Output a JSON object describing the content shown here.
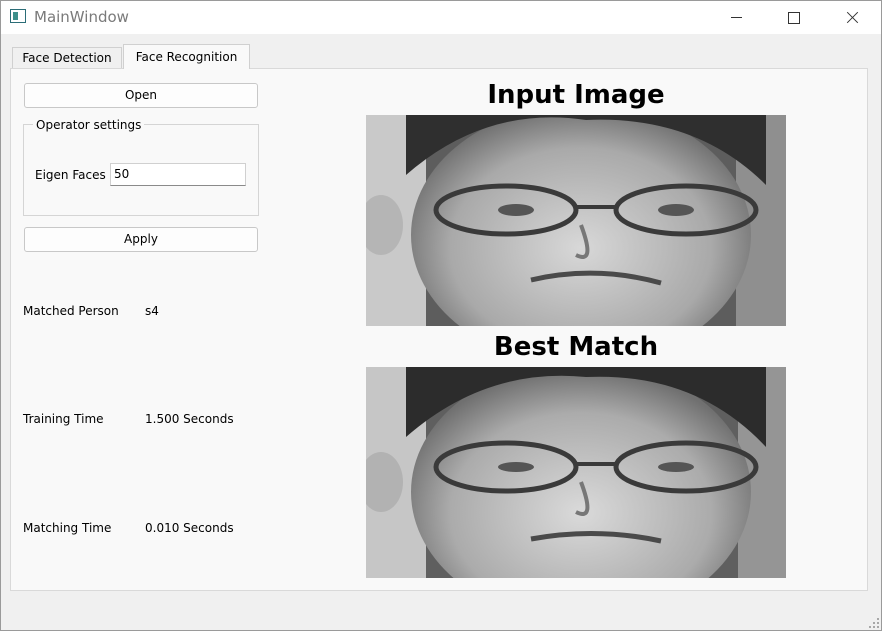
{
  "window": {
    "title": "MainWindow"
  },
  "tabs": [
    {
      "label": "Face Detection"
    },
    {
      "label": "Face Recognition"
    }
  ],
  "controls": {
    "open_label": "Open",
    "apply_label": "Apply",
    "group_title": "Operator settings",
    "eigen_label": "Eigen Faces",
    "eigen_value": "50"
  },
  "results": {
    "matched_person_label": "Matched Person",
    "matched_person_value": "s4",
    "training_time_label": "Training Time",
    "training_time_value": "1.500 Seconds",
    "matching_time_label": "Matching Time",
    "matching_time_value": "0.010 Seconds"
  },
  "images": {
    "input_heading": "Input Image",
    "best_heading": "Best Match"
  },
  "icons": {
    "app": "app-icon",
    "minimize": "minimize-icon",
    "maximize": "maximize-icon",
    "close": "close-icon",
    "grip": "resize-grip-icon"
  }
}
